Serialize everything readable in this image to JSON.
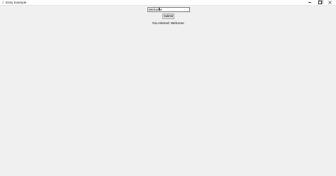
{
  "window": {
    "title": "Entry Example"
  },
  "form": {
    "entry_value": "Welcome",
    "submit_label": "Submit",
    "output_text": "You entered: Welcome"
  }
}
